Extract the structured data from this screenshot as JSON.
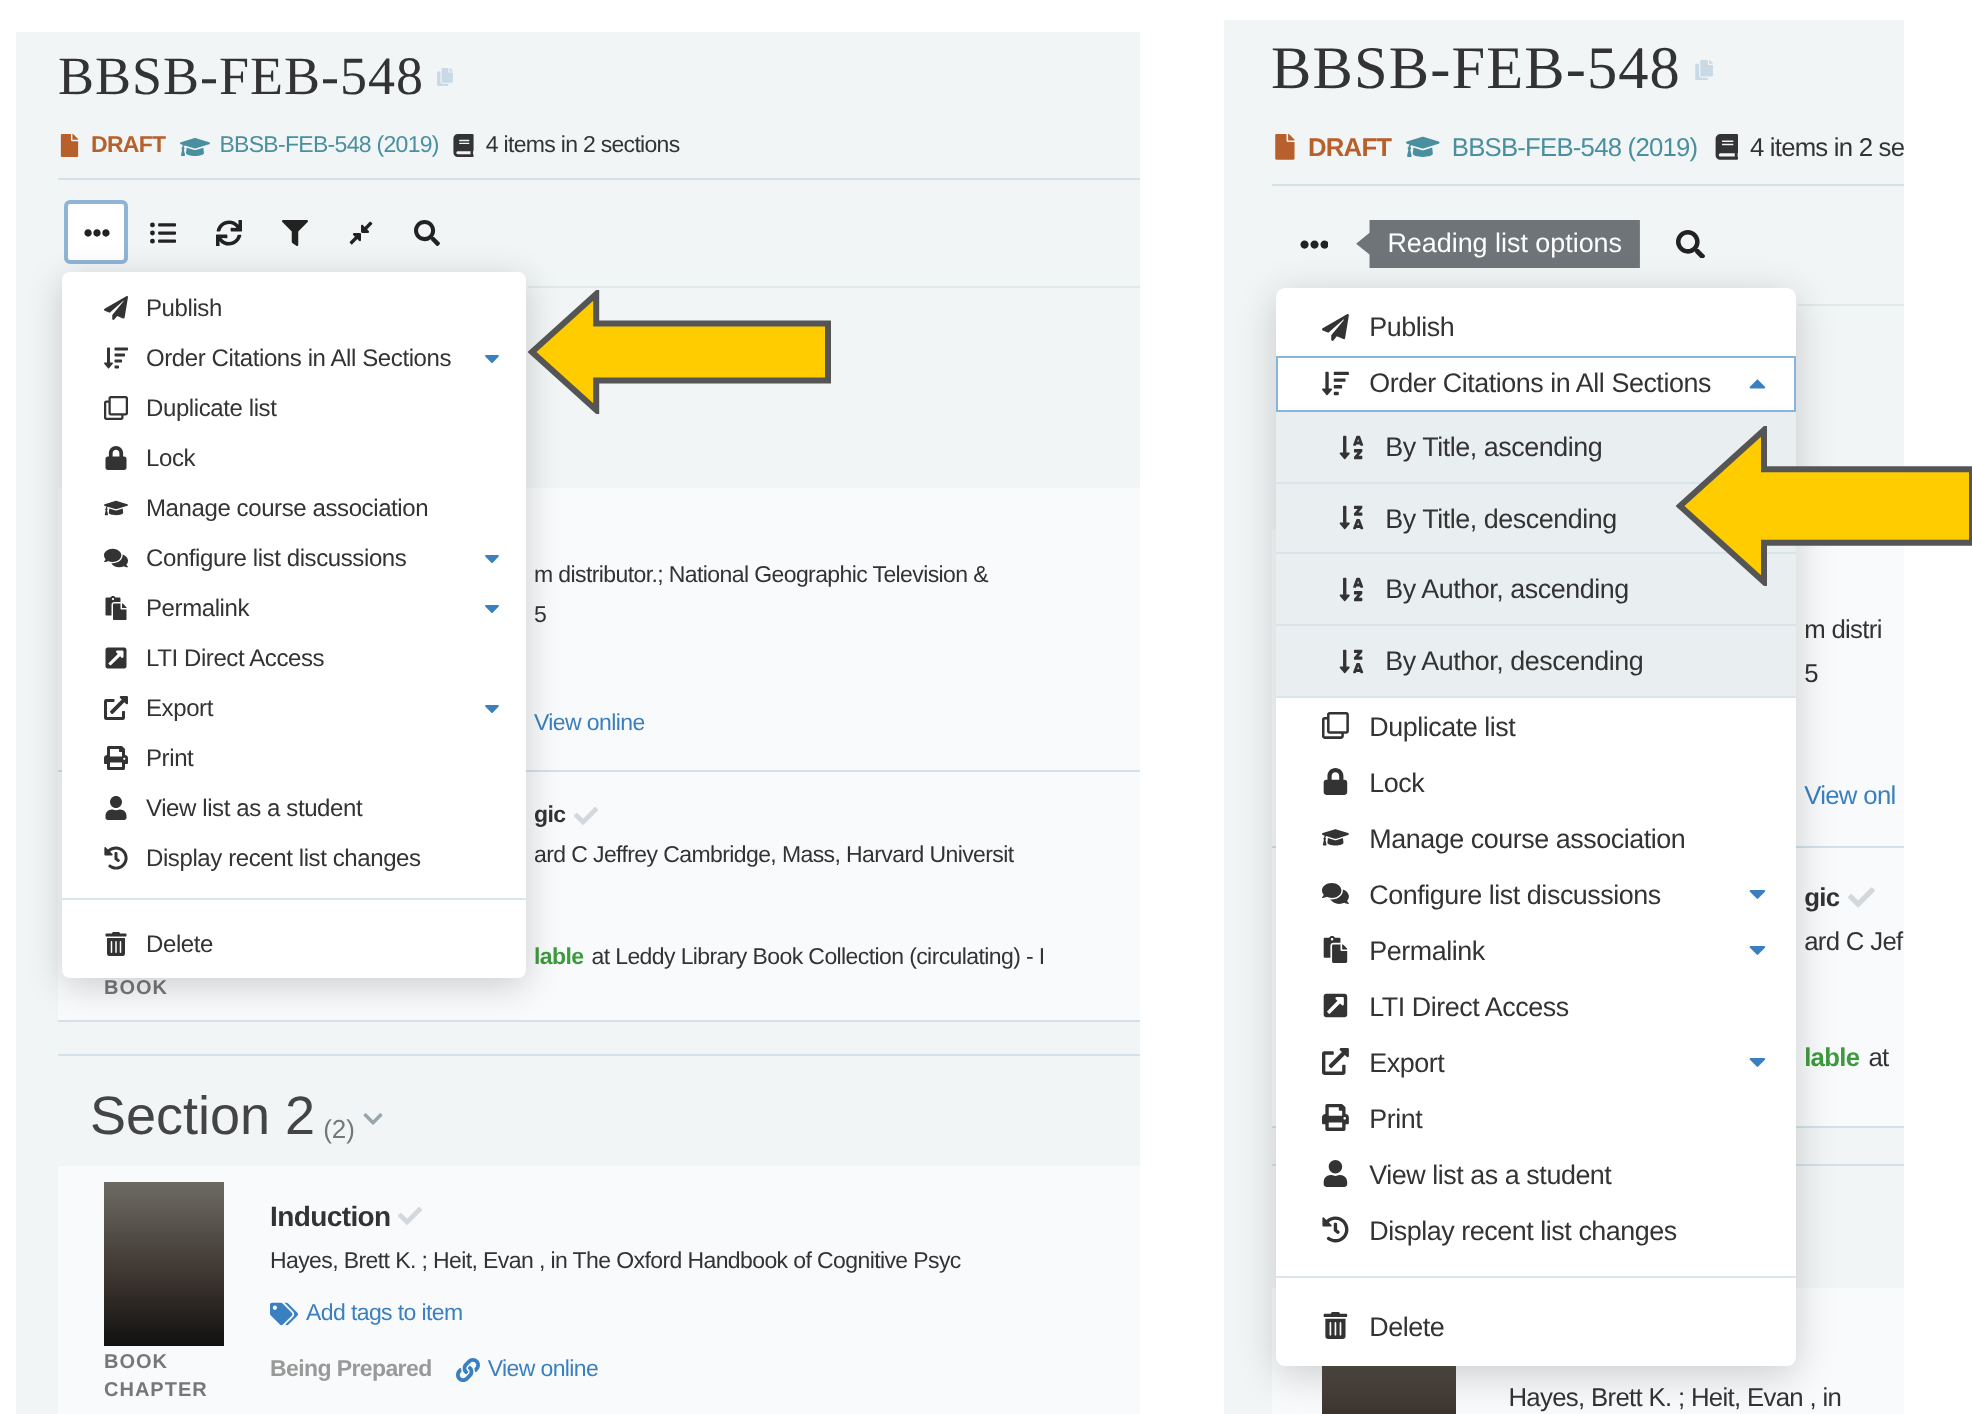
{
  "panels": [
    {
      "title": "BBSB-FEB-548",
      "status": "DRAFT",
      "course": "BBSB-FEB-548 (2019)",
      "summary": "4 items in 2 sections",
      "toolbar": [
        {
          "kind": "more",
          "selected": true
        },
        {
          "kind": "list",
          "selected": false
        },
        {
          "kind": "refresh",
          "selected": false
        },
        {
          "kind": "filter",
          "selected": false
        },
        {
          "kind": "collapse",
          "selected": false
        },
        {
          "kind": "search",
          "selected": false
        }
      ],
      "menu": {
        "items": [
          {
            "label": "Publish"
          },
          {
            "label": "Order Citations in All Sections",
            "expanded": false
          },
          {
            "label": "Duplicate list"
          },
          {
            "label": "Lock"
          },
          {
            "label": "Manage course association"
          },
          {
            "label": "Configure list discussions",
            "expanded": false
          },
          {
            "label": "Permalink",
            "expanded": false
          },
          {
            "label": "LTI Direct Access"
          },
          {
            "label": "Export",
            "expanded": false
          },
          {
            "label": "Print"
          },
          {
            "label": "View list as a student"
          },
          {
            "label": "Display recent list changes"
          },
          {
            "label": "Delete"
          }
        ]
      },
      "citations": [
        {
          "details": "m distributor.; National Geographic Television &",
          "date": "5",
          "link": "View online"
        },
        {
          "title": "gic",
          "details": "ard C Jeffrey Cambridge, Mass, Harvard Universit",
          "availability": "lable",
          "location": "at Leddy Library Book Collection (circulating) - I",
          "type": "BOOK"
        }
      ],
      "section": {
        "title": "Section 2",
        "count": "(2)",
        "citation": {
          "type": "BOOK CHAPTER",
          "title": "Induction",
          "details": "Hayes, Brett K. ; Heit, Evan , in The Oxford Handbook of Cognitive Psyc",
          "tag_link": "Add tags to item",
          "status": "Being Prepared",
          "link": "View online"
        }
      }
    },
    {
      "title": "BBSB-FEB-548",
      "status": "DRAFT",
      "course": "BBSB-FEB-548 (2019)",
      "summary": "4 items in 2 se",
      "tooltip": "Reading list options",
      "toolbar": [
        {
          "kind": "more",
          "selected": false
        },
        {
          "kind": "search",
          "selected": false
        }
      ],
      "menu": {
        "items": [
          {
            "label": "Publish"
          },
          {
            "label": "Order Citations in All Sections",
            "expanded": true,
            "children": [
              {
                "label": "By Title, ascending",
                "kind": "ascending"
              },
              {
                "label": "By Title, descending",
                "kind": "descending"
              },
              {
                "label": "By Author, ascending",
                "kind": "ascending"
              },
              {
                "label": "By Author, descending",
                "kind": "descending"
              }
            ]
          },
          {
            "label": "Duplicate list"
          },
          {
            "label": "Lock"
          },
          {
            "label": "Manage course association"
          },
          {
            "label": "Configure list discussions",
            "expanded": false
          },
          {
            "label": "Permalink",
            "expanded": false
          },
          {
            "label": "LTI Direct Access"
          },
          {
            "label": "Export",
            "expanded": false
          },
          {
            "label": "Print"
          },
          {
            "label": "View list as a student"
          },
          {
            "label": "Display recent list changes"
          },
          {
            "label": "Delete"
          }
        ]
      },
      "citations": [
        {
          "details": "m distri",
          "date": "5",
          "link": "View onl"
        },
        {
          "title": "gic",
          "details": "ard C Jef",
          "availability": "lable",
          "location": "at"
        }
      ],
      "section": {
        "citation": {
          "details": "Hayes, Brett K. ; Heit, Evan , in"
        }
      }
    }
  ]
}
